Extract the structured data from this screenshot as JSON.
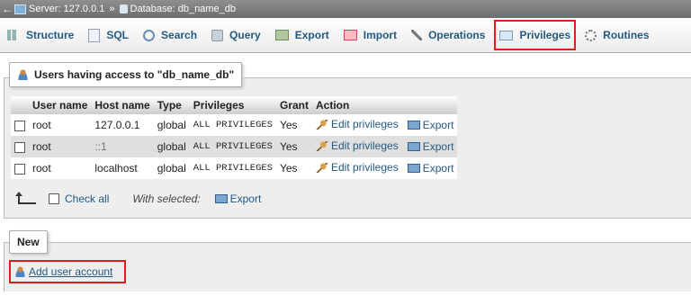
{
  "breadcrumb": {
    "server": "Server: 127.0.0.1",
    "separator": "»",
    "database": "Database: db_name_db"
  },
  "tabs": [
    {
      "label": "Structure",
      "icon": "structure-icon"
    },
    {
      "label": "SQL",
      "icon": "sql-icon"
    },
    {
      "label": "Search",
      "icon": "search-icon"
    },
    {
      "label": "Query",
      "icon": "query-icon"
    },
    {
      "label": "Export",
      "icon": "export-icon"
    },
    {
      "label": "Import",
      "icon": "import-icon"
    },
    {
      "label": "Operations",
      "icon": "operations-icon"
    },
    {
      "label": "Privileges",
      "icon": "privileges-icon",
      "active": true
    },
    {
      "label": "Routines",
      "icon": "routines-icon"
    }
  ],
  "users_panel": {
    "legend": "Users having access to \"db_name_db\"",
    "columns": [
      "",
      "User name",
      "Host name",
      "Type",
      "Privileges",
      "Grant",
      "Action"
    ],
    "rows": [
      {
        "user": "root",
        "host": "127.0.0.1",
        "type": "global",
        "privileges": "ALL PRIVILEGES",
        "grant": "Yes",
        "edit": "Edit privileges",
        "export": "Export"
      },
      {
        "user": "root",
        "host": "::1",
        "type": "global",
        "privileges": "ALL PRIVILEGES",
        "grant": "Yes",
        "edit": "Edit privileges",
        "export": "Export"
      },
      {
        "user": "root",
        "host": "localhost",
        "type": "global",
        "privileges": "ALL PRIVILEGES",
        "grant": "Yes",
        "edit": "Edit privileges",
        "export": "Export"
      }
    ],
    "check_all": "Check all",
    "with_selected": "With selected:",
    "bulk_export": "Export"
  },
  "new_section": {
    "legend": "New",
    "add_user": "Add user account"
  },
  "colors": {
    "highlight": "#e01d1d",
    "link": "#235a81",
    "panel_bg": "#eeeeee"
  }
}
